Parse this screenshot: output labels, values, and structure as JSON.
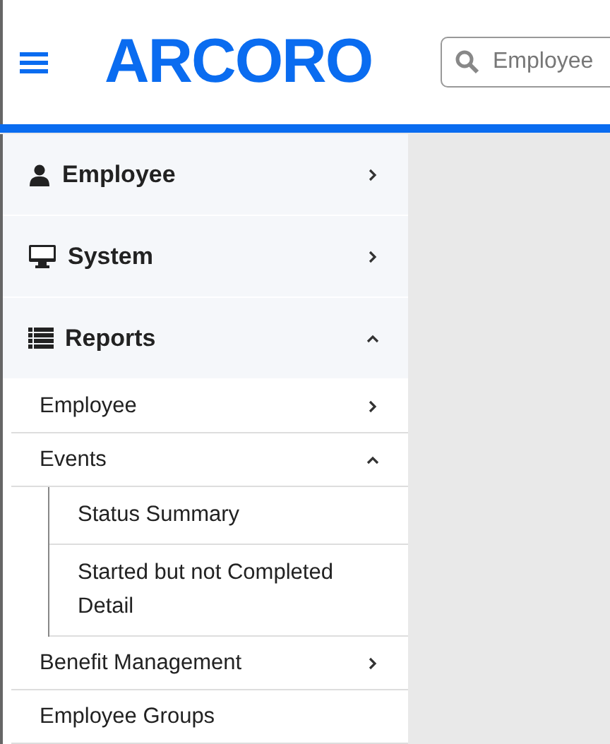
{
  "header": {
    "logo": "ARCORO",
    "search": {
      "placeholder": "Employee"
    }
  },
  "sidebar": {
    "sections": [
      {
        "label": "Employee",
        "kind": "user",
        "expanded": false
      },
      {
        "label": "System",
        "kind": "monitor",
        "expanded": false
      },
      {
        "label": "Reports",
        "kind": "list",
        "expanded": true,
        "children": [
          {
            "label": "Employee",
            "kind": "group",
            "expanded": false
          },
          {
            "label": "Events",
            "kind": "group",
            "expanded": true,
            "children": [
              {
                "label": "Status Summary"
              },
              {
                "label": "Started but not Completed Detail"
              }
            ]
          },
          {
            "label": "Benefit Management",
            "kind": "group",
            "expanded": false
          },
          {
            "label": "Employee Groups",
            "kind": "link"
          }
        ]
      }
    ]
  }
}
